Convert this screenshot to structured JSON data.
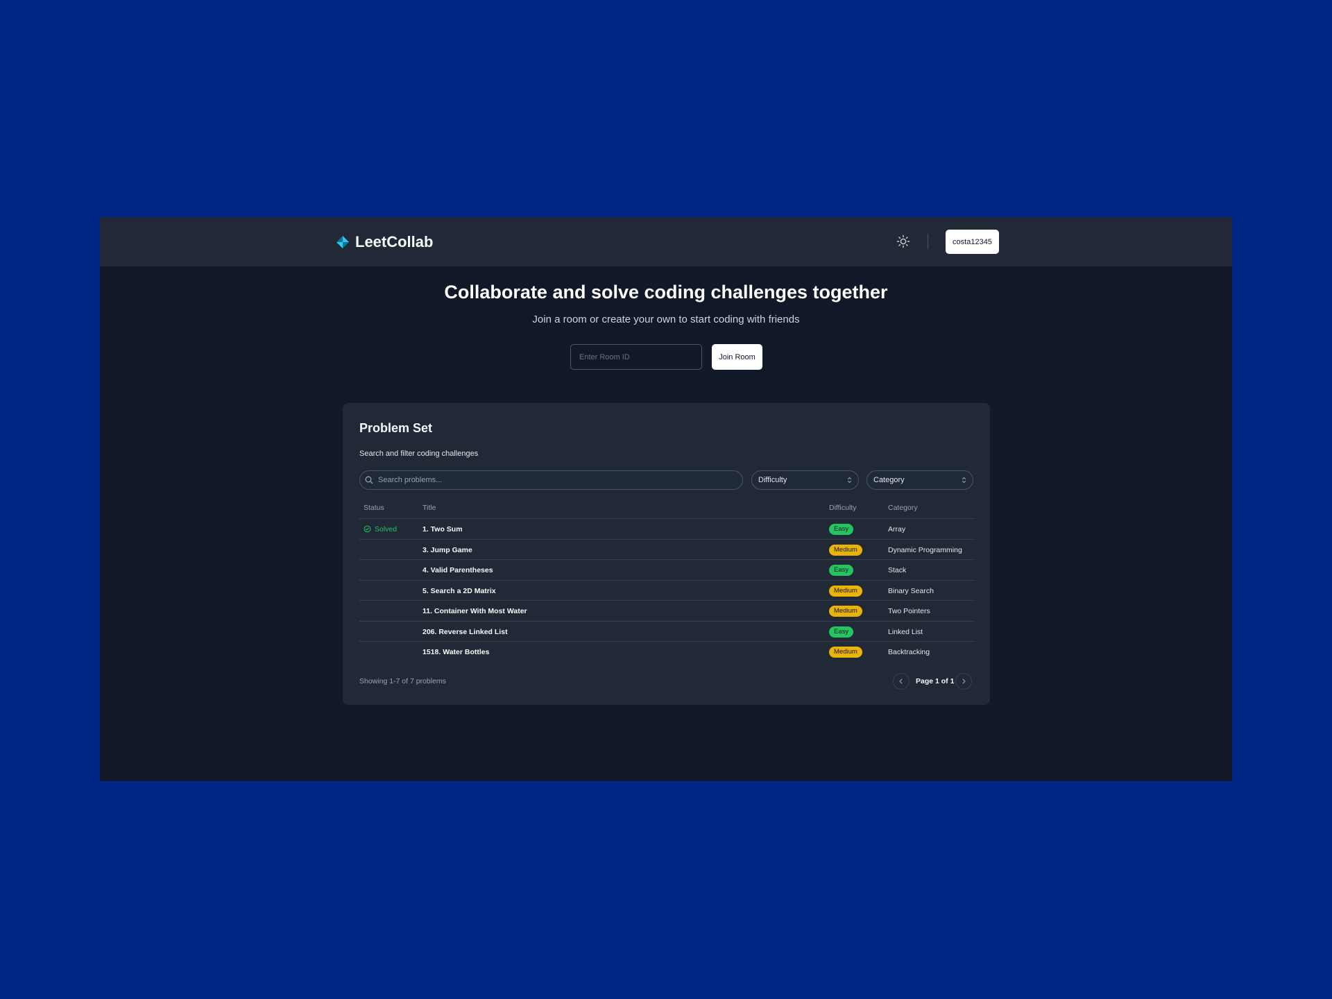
{
  "app": {
    "name": "LeetCollab"
  },
  "header": {
    "user_label": "costa12345"
  },
  "hero": {
    "title": "Collaborate and solve coding challenges together",
    "subtitle": "Join a room or create your own to start coding with friends",
    "room_input_placeholder": "Enter Room ID",
    "join_label": "Join Room"
  },
  "problems": {
    "title": "Problem Set",
    "subtitle": "Search and filter coding challenges",
    "search_placeholder": "Search problems...",
    "difficulty_filter": "Difficulty",
    "category_filter": "Category",
    "columns": [
      "Status",
      "Title",
      "Difficulty",
      "Category"
    ],
    "rows": [
      {
        "status": "Solved",
        "title": "1. Two Sum",
        "difficulty": "Easy",
        "category": "Array"
      },
      {
        "status": "",
        "title": "3. Jump Game",
        "difficulty": "Medium",
        "category": "Dynamic Programming"
      },
      {
        "status": "",
        "title": "4. Valid Parentheses",
        "difficulty": "Easy",
        "category": "Stack"
      },
      {
        "status": "",
        "title": "5. Search a 2D Matrix",
        "difficulty": "Medium",
        "category": "Binary Search"
      },
      {
        "status": "",
        "title": "11. Container With Most Water",
        "difficulty": "Medium",
        "category": "Two Pointers"
      },
      {
        "status": "",
        "title": "206. Reverse Linked List",
        "difficulty": "Easy",
        "category": "Linked List"
      },
      {
        "status": "",
        "title": "1518. Water Bottles",
        "difficulty": "Medium",
        "category": "Backtracking"
      }
    ],
    "showing": "Showing 1-7 of 7 problems",
    "page_label": "Page 1 of 1"
  },
  "colors": {
    "desktop": "#002584",
    "topbar": "#212936",
    "page": "#111827",
    "card": "#212936",
    "easy": "#22c55e",
    "medium": "#eab308",
    "solved": "#22c55e",
    "brand_accent": "#38bdf8"
  },
  "icons": {
    "brand": "diamond-logo-icon",
    "theme": "sun-icon",
    "search": "search-icon",
    "select": "chevron-up-down-icon",
    "solved": "check-circle-icon",
    "prev": "chevron-left-icon",
    "next": "chevron-right-icon"
  }
}
